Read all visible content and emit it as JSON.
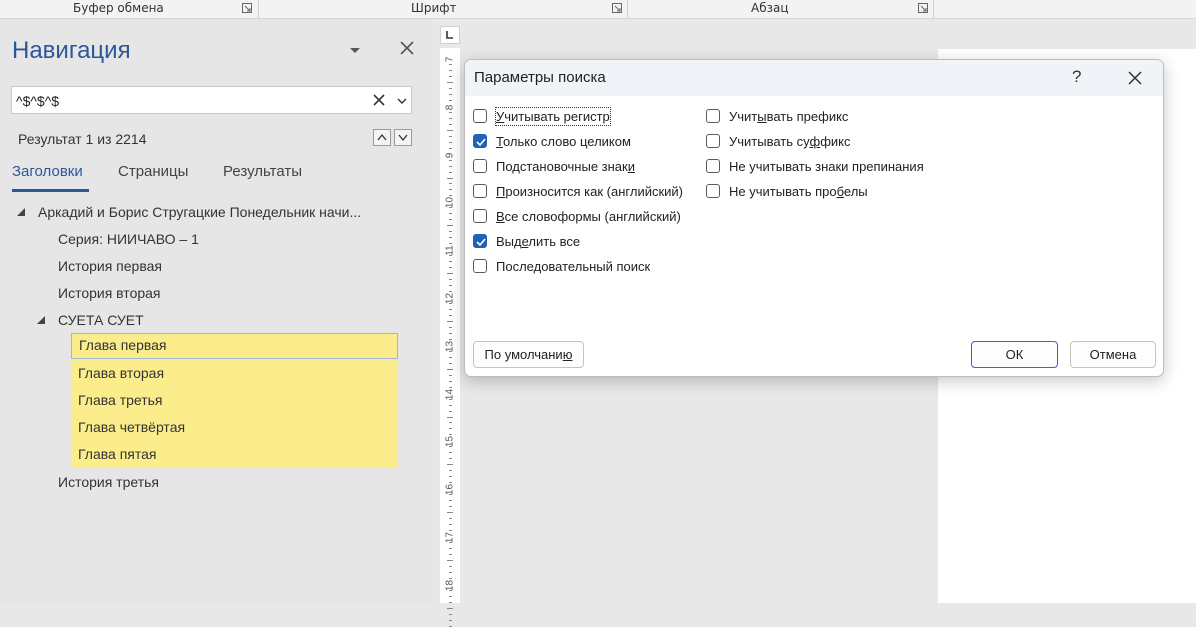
{
  "ribbon": {
    "groups": [
      {
        "label": "Буфер обмена"
      },
      {
        "label": "Шрифт"
      },
      {
        "label": "Абзац"
      }
    ]
  },
  "navigation": {
    "title": "Навигация",
    "search_value": "^$^$^$",
    "result_count": "Результат 1 из 2214",
    "tabs": [
      {
        "label": "Заголовки",
        "active": true
      },
      {
        "label": "Страницы",
        "active": false
      },
      {
        "label": "Результаты",
        "active": false
      }
    ],
    "tree": [
      {
        "label": "Аркадий и Борис Стругацкие  Понедельник начи...",
        "level": 0,
        "expanded": true
      },
      {
        "label": "Серия: НИИЧАВО – 1",
        "level": 1
      },
      {
        "label": "История первая",
        "level": 1
      },
      {
        "label": "История вторая",
        "level": 1
      },
      {
        "label": "СУЕТА СУЕТ",
        "level": 1,
        "expanded": true
      },
      {
        "label": "Глава первая",
        "level": 2,
        "highlighted": true,
        "selected": true
      },
      {
        "label": "Глава вторая",
        "level": 2,
        "highlighted": true
      },
      {
        "label": "Глава третья",
        "level": 2,
        "highlighted": true
      },
      {
        "label": "Глава четвёртая",
        "level": 2,
        "highlighted": true
      },
      {
        "label": "Глава пятая",
        "level": 2,
        "highlighted": true
      },
      {
        "label": "История третья",
        "level": 1
      }
    ],
    "highlight_color": "#fbec8c",
    "accent_color": "#2b579a"
  },
  "ruler": {
    "numbers": [
      "7",
      "8",
      "9",
      "10",
      "11",
      "12",
      "13",
      "14",
      "15",
      "16",
      "17",
      "18"
    ]
  },
  "dialog": {
    "title": "Параметры поиска",
    "help": "?",
    "options_left": [
      {
        "pre": "",
        "key": "У",
        "post": "читывать регистр",
        "checked": false,
        "focused": true
      },
      {
        "pre": "",
        "key": "Т",
        "post": "олько слово целиком",
        "checked": true
      },
      {
        "pre": "Подстановочные знак",
        "key": "и",
        "post": "",
        "checked": false
      },
      {
        "pre": "",
        "key": "П",
        "post": "роизносится как (английский)",
        "checked": false
      },
      {
        "pre": "",
        "key": "В",
        "post": "се словоформы (английский)",
        "checked": false
      },
      {
        "pre": "Выд",
        "key": "е",
        "post": "лить все",
        "checked": true
      },
      {
        "pre": "Последовательный поиск",
        "key": "",
        "post": "",
        "checked": false
      }
    ],
    "options_right": [
      {
        "pre": "Учит",
        "key": "ы",
        "post": "вать префикс",
        "checked": false
      },
      {
        "pre": "Учитывать су",
        "key": "ф",
        "post": "фикс",
        "checked": false
      },
      {
        "pre": "Не учитывать знаки препинания",
        "key": "",
        "post": "",
        "checked": false
      },
      {
        "pre": "Не учитывать про",
        "key": "б",
        "post": "елы",
        "checked": false
      }
    ],
    "default_button": {
      "pre": "По умолчани",
      "key": "ю",
      "post": ""
    },
    "ok_label": "ОК",
    "cancel_label": "Отмена",
    "check_color": "#1e63b8"
  }
}
